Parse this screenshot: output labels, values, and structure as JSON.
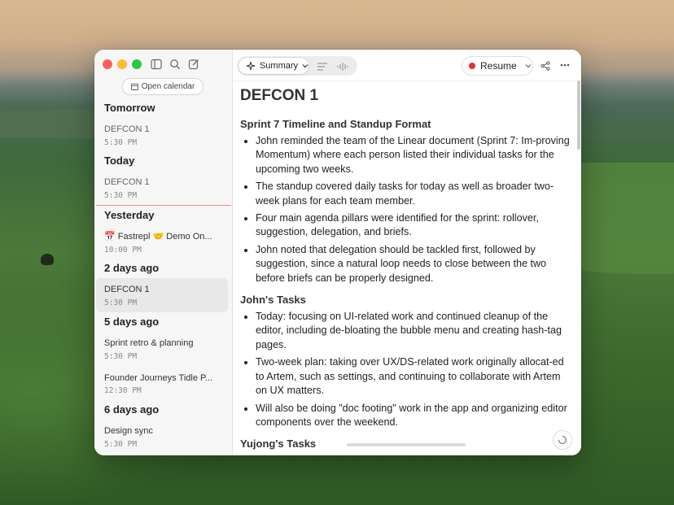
{
  "sidebar": {
    "open_calendar": "Open calendar",
    "sections": [
      {
        "title": "Tomorrow",
        "items": [
          {
            "title": "DEFCON 1",
            "time": "5:30 PM"
          }
        ]
      },
      {
        "title": "Today",
        "items": [
          {
            "title": "DEFCON 1",
            "time": "5:30 PM"
          }
        ]
      },
      {
        "title": "Yesterday",
        "items": [
          {
            "title": "📅 Fastrepl 🤝 Demo On...",
            "time": "10:00 PM"
          }
        ]
      },
      {
        "title": "2 days ago",
        "items": [
          {
            "title": "DEFCON 1",
            "time": "5:30 PM"
          }
        ]
      },
      {
        "title": "5 days ago",
        "items": [
          {
            "title": "Sprint retro & planning",
            "time": "5:30 PM"
          },
          {
            "title": "Founder Journeys Tidle P...",
            "time": "12:30 PM"
          }
        ]
      },
      {
        "title": "6 days ago",
        "items": [
          {
            "title": "Design sync",
            "time": "5:30 PM"
          }
        ]
      }
    ]
  },
  "toolbar": {
    "summary_label": "Summary",
    "resume_label": "Resume"
  },
  "document": {
    "title": "DEFCON 1",
    "sections": [
      {
        "heading": "Sprint 7 Timeline and Standup Format",
        "bullets": [
          "John reminded the team of the Linear document (Sprint 7: Im-proving Momentum) where each person listed their individual tasks for the upcoming two weeks.",
          "The standup covered daily tasks for today as well as broader two-week plans for each team member.",
          "Four main agenda pillars were identified for the sprint: rollover, suggestion, delegation, and briefs.",
          "John noted that delegation should be tackled first, followed by suggestion, since a natural loop needs to close between the two before briefs can be properly designed."
        ]
      },
      {
        "heading": "John's Tasks",
        "bullets": [
          "Today: focusing on UI-related work and continued cleanup of the editor, including de-bloating the bubble menu and creating hash-tag pages.",
          "Two-week plan: taking over UX/DS-related work originally allocat-ed to Artem, such as settings, and continuing to collaborate with Artem on UX matters.",
          "Will also be doing \"doc footing\" work in the app and organizing editor components over the weekend."
        ]
      },
      {
        "heading": "Yujong's Tasks",
        "bullets": []
      }
    ]
  },
  "colors": {
    "accent_red": "#e5312b",
    "now_line": "#ef8d86"
  }
}
